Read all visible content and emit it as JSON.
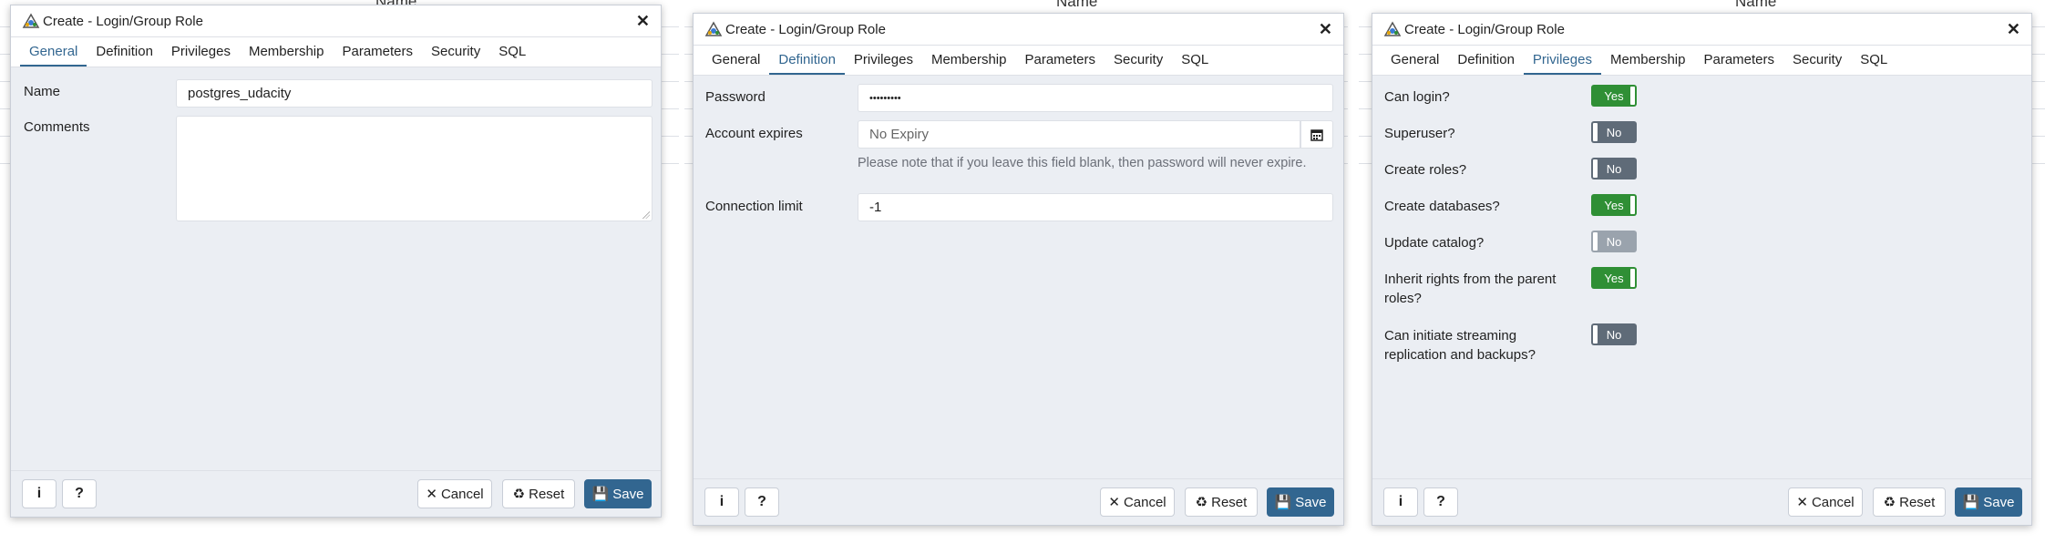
{
  "background_header": "Name",
  "dialogs": [
    {
      "title": "Create - Login/Group Role",
      "tabs": [
        "General",
        "Definition",
        "Privileges",
        "Membership",
        "Parameters",
        "Security",
        "SQL"
      ],
      "active_tab": "General",
      "fields": {
        "name_label": "Name",
        "name_value": "postgres_udacity",
        "comments_label": "Comments",
        "comments_value": ""
      }
    },
    {
      "title": "Create - Login/Group Role",
      "tabs": [
        "General",
        "Definition",
        "Privileges",
        "Membership",
        "Parameters",
        "Security",
        "SQL"
      ],
      "active_tab": "Definition",
      "fields": {
        "password_label": "Password",
        "password_value": "•••••••••",
        "expires_label": "Account expires",
        "expires_placeholder": "No Expiry",
        "expires_hint": "Please note that if you leave this field blank, then password will never expire.",
        "connlimit_label": "Connection limit",
        "connlimit_value": "-1"
      }
    },
    {
      "title": "Create - Login/Group Role",
      "tabs": [
        "General",
        "Definition",
        "Privileges",
        "Membership",
        "Parameters",
        "Security",
        "SQL"
      ],
      "active_tab": "Privileges",
      "privileges": [
        {
          "label": "Can login?",
          "value": "Yes",
          "state": "on"
        },
        {
          "label": "Superuser?",
          "value": "No",
          "state": "off"
        },
        {
          "label": "Create roles?",
          "value": "No",
          "state": "off"
        },
        {
          "label": "Create databases?",
          "value": "Yes",
          "state": "on"
        },
        {
          "label": "Update catalog?",
          "value": "No",
          "state": "disabled"
        },
        {
          "label": "Inherit rights from the parent roles?",
          "value": "Yes",
          "state": "on"
        },
        {
          "label": "Can initiate streaming replication and backups?",
          "value": "No",
          "state": "off"
        }
      ]
    }
  ],
  "footer": {
    "info_label": "i",
    "help_label": "?",
    "cancel_label": "Cancel",
    "reset_label": "Reset",
    "save_label": "Save"
  },
  "colors": {
    "accent": "#326690",
    "toggle_on": "#2f8f35",
    "toggle_off": "#5f6b78"
  }
}
